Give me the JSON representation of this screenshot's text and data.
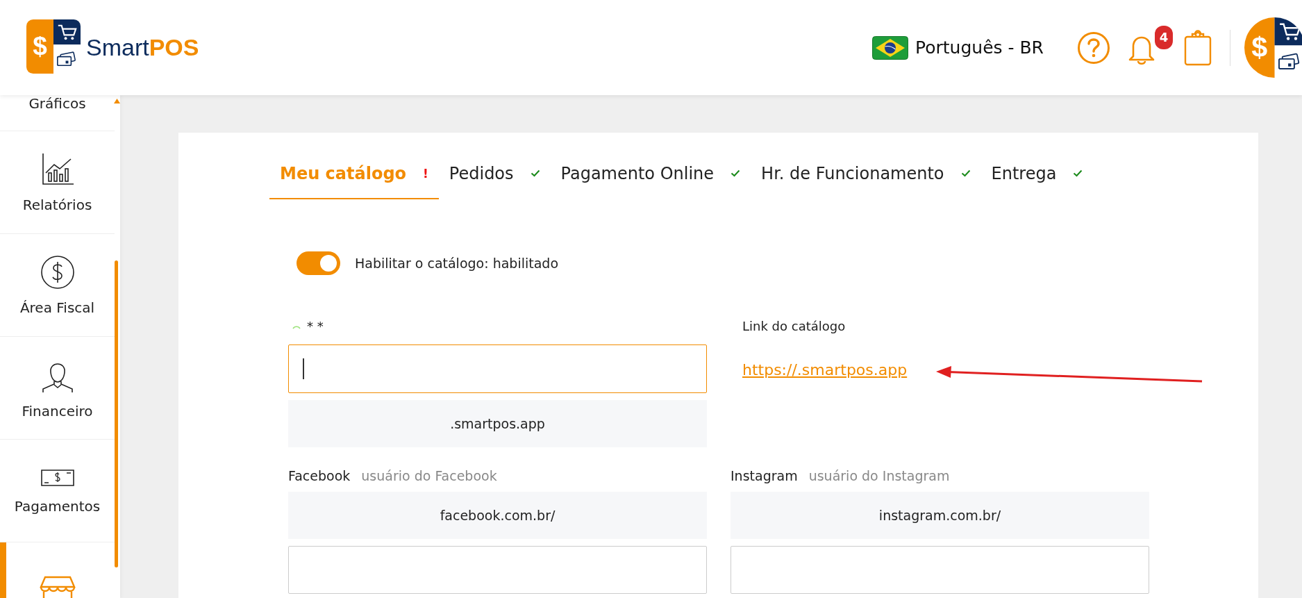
{
  "header": {
    "logo": {
      "symbol": "$",
      "brand_first": "Smart",
      "brand_second": "POS"
    },
    "language": {
      "label": "Português - BR"
    },
    "notifications": {
      "badge": "4"
    },
    "avatar": {
      "symbol": "$"
    }
  },
  "sidebar": {
    "items": [
      {
        "kind": "charts",
        "label": "Gráficos",
        "selected": false
      },
      {
        "kind": "reports",
        "label": "Relatórios",
        "selected": false
      },
      {
        "kind": "fiscal",
        "label": "Área Fiscal",
        "selected": false
      },
      {
        "kind": "finance",
        "label": "Financeiro",
        "selected": false
      },
      {
        "kind": "payments",
        "label": "Pagamentos",
        "selected": false
      },
      {
        "kind": "store",
        "selected": true
      }
    ]
  },
  "tabs": [
    {
      "label": "Meu catálogo",
      "selected": true,
      "complete": false,
      "mark": "!"
    },
    {
      "label": "Pedidos",
      "selected": false,
      "complete": true
    },
    {
      "label": "Pagamento Online",
      "selected": false,
      "complete": true
    },
    {
      "label": "Hr. de Funcionamento",
      "selected": false,
      "complete": true
    },
    {
      "label": "Entrega",
      "selected": false,
      "complete": true
    }
  ],
  "catalog": {
    "enabled": true,
    "enabled_label": "Habilitar o catálogo: habilitado",
    "subdomain": {
      "label": "* *",
      "loading": true,
      "focused": true,
      "suffix": ".smartpos.app"
    },
    "link": {
      "label": "Link do catálogo",
      "url": "https://.smartpos.app"
    },
    "socials": [
      {
        "label": "Facebook",
        "hint": "usuário do Facebook",
        "prefix": "facebook.com.br/"
      },
      {
        "label": "Instagram",
        "hint": "usuário do Instagram",
        "prefix": "instagram.com.br/"
      }
    ]
  }
}
